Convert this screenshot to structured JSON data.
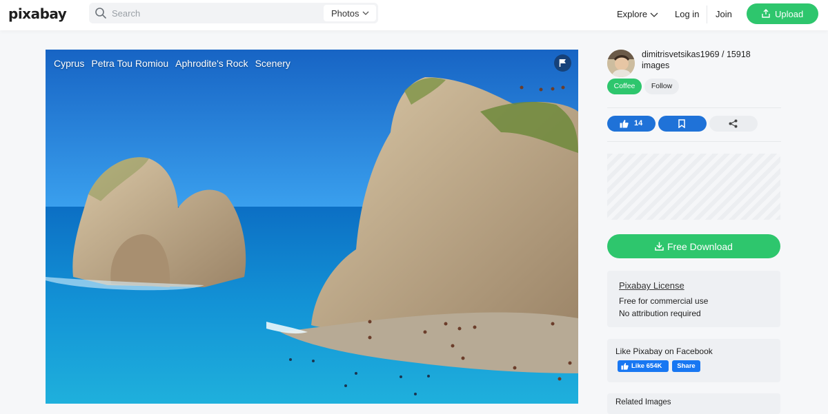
{
  "header": {
    "logo": "pixabay",
    "search_placeholder": "Search",
    "search_type": "Photos",
    "nav": {
      "explore": "Explore",
      "login": "Log in",
      "join": "Join",
      "upload": "Upload"
    }
  },
  "photo": {
    "tags": [
      "Cyprus",
      "Petra Tou Romiou",
      "Aphrodite's Rock",
      "Scenery"
    ]
  },
  "author": {
    "line": "dimitrisvetsikas1969 / 15918 images",
    "coffee": "Coffee",
    "follow": "Follow"
  },
  "actions": {
    "likes": "14"
  },
  "download": {
    "label": "Free Download"
  },
  "license": {
    "title": "Pixabay License",
    "line1": "Free for commercial use",
    "line2": "No attribution required"
  },
  "facebook": {
    "title": "Like Pixabay on Facebook",
    "like": "Like 654K",
    "share": "Share"
  },
  "related": {
    "title": "Related Images"
  },
  "colors": {
    "brand_green": "#2ec66d",
    "action_blue": "#1f72d8",
    "facebook_blue": "#1877f2"
  }
}
